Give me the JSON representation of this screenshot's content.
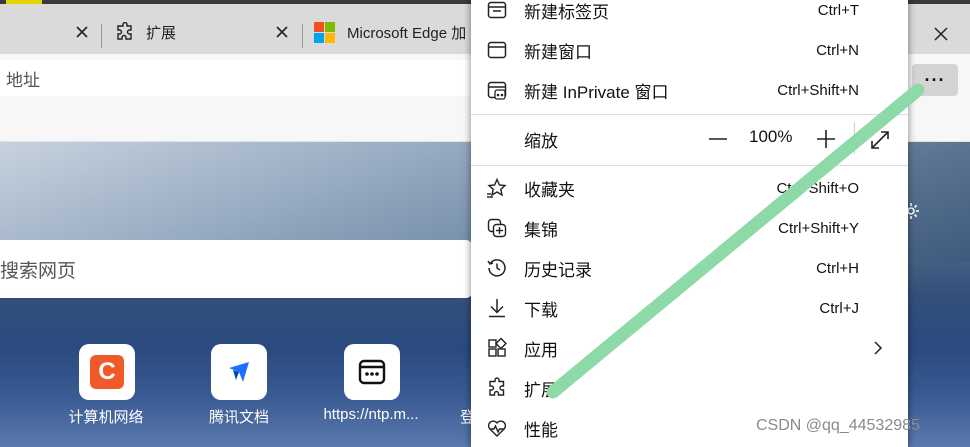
{
  "tabs": [
    {
      "label": ""
    },
    {
      "label": "扩展"
    },
    {
      "label": "Microsoft Edge 加"
    }
  ],
  "address": {
    "text": "地址"
  },
  "search": {
    "placeholder": "搜索网页"
  },
  "tiles": [
    {
      "label": "计算机网络",
      "color": "#f05a28"
    },
    {
      "label": "腾讯文档",
      "color": "#1e6fff"
    },
    {
      "label": "https://ntp.m...",
      "color": "#111111"
    },
    {
      "label": "登"
    }
  ],
  "menu": {
    "items": [
      {
        "label": "新建标签页",
        "shortcut": "Ctrl+T",
        "icon": "new-tab-icon"
      },
      {
        "label": "新建窗口",
        "shortcut": "Ctrl+N",
        "icon": "new-window-icon"
      },
      {
        "label": "新建 InPrivate 窗口",
        "shortcut": "Ctrl+Shift+N",
        "icon": "inprivate-icon"
      },
      {
        "label": "缩放",
        "icon": ""
      },
      {
        "label": "收藏夹",
        "shortcut": "Ctrl+Shift+O",
        "icon": "favorites-icon"
      },
      {
        "label": "集锦",
        "shortcut": "Ctrl+Shift+Y",
        "icon": "collections-icon"
      },
      {
        "label": "历史记录",
        "shortcut": "Ctrl+H",
        "icon": "history-icon"
      },
      {
        "label": "下载",
        "shortcut": "Ctrl+J",
        "icon": "download-icon"
      },
      {
        "label": "应用",
        "icon": "apps-icon"
      },
      {
        "label": "扩展",
        "icon": "extensions-icon"
      },
      {
        "label": "性能",
        "icon": "performance-icon"
      }
    ],
    "zoom": {
      "value": "100%",
      "minus": "—",
      "plus": "+"
    }
  },
  "more_button": {
    "label": "···"
  },
  "watermark": "CSDN @qq_44532985",
  "annotation_color": "#8ed9a8"
}
